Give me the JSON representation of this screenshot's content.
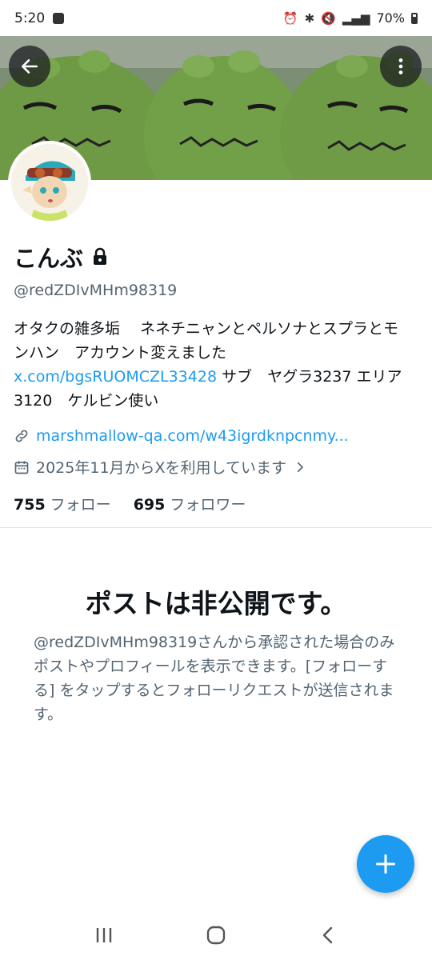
{
  "status_bar": {
    "time": "5:20",
    "app_badge_label": "App",
    "battery": "70%"
  },
  "profile": {
    "display_name": "こんぶ",
    "handle": "@redZDIvMHm98319",
    "bio_text": "オタクの雑多垢　 ネネチニャンとペルソナとスプラとモンハン　アカウント変えました　",
    "bio_link": "x.com/bgsRUOMCZL33428",
    "bio_tail": "  サブ　ヤグラ3237 エリア3120　ケルビン使い",
    "website": "marshmallow-qa.com/w43igrdknpcnmy...",
    "joined": "2025年11月からXを利用しています",
    "following_count": "755",
    "following_label": "フォロー",
    "followers_count": "695",
    "followers_label": "フォロワー"
  },
  "private_notice": {
    "title": "ポストは非公開です。",
    "body": "@redZDIvMHm98319さんから承認された場合のみポストやプロフィールを表示できます。[フォローする] をタップするとフォローリクエストが送信されます。"
  },
  "icons": {
    "back": "arrow-left-icon",
    "more": "more-vertical-icon",
    "lock": "lock-icon",
    "link": "link-icon",
    "calendar": "calendar-icon",
    "chevron": "chevron-right-icon",
    "compose": "plus-icon"
  },
  "colors": {
    "accent": "#1d9bf0",
    "text_primary": "#0f1419",
    "text_secondary": "#536471"
  }
}
